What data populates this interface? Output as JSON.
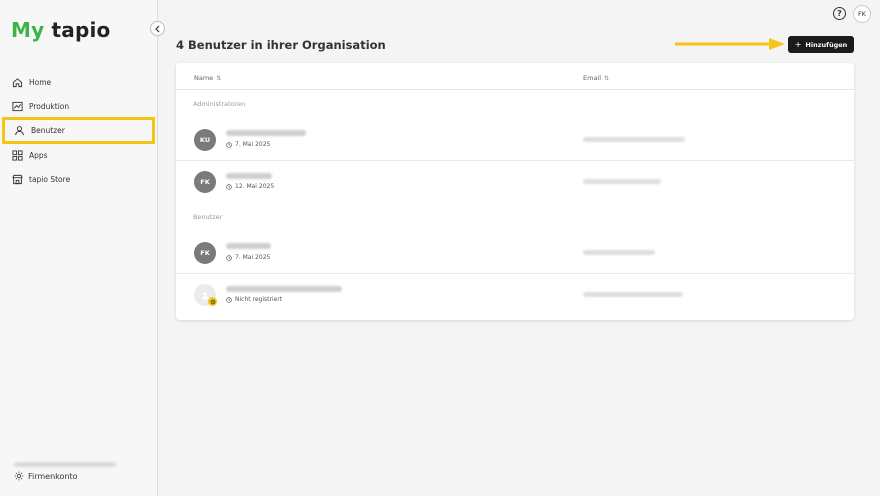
{
  "app": {
    "logo_my": "My",
    "logo_tapio": "tapio"
  },
  "sidebar": {
    "items": [
      {
        "label": "Home",
        "icon": "home-icon"
      },
      {
        "label": "Produktion",
        "icon": "chart-icon"
      },
      {
        "label": "Benutzer",
        "icon": "user-icon",
        "active": true
      },
      {
        "label": "Apps",
        "icon": "apps-grid-icon"
      },
      {
        "label": "tapio Store",
        "icon": "store-icon"
      }
    ],
    "account_label": "Firmenkonto"
  },
  "topbar": {
    "help": "?",
    "avatar_initials": "FK"
  },
  "page": {
    "title": "4 Benutzer in ihrer Organisation",
    "add_button": "Hinzufügen"
  },
  "table": {
    "columns": {
      "name": "Name",
      "email": "Email"
    },
    "groups": [
      {
        "label": "Administratoren",
        "users": [
          {
            "initials": "KU",
            "date": "7. Mai 2025"
          },
          {
            "initials": "FK",
            "date": "12. Mai 2025"
          }
        ]
      },
      {
        "label": "Benutzer",
        "users": [
          {
            "initials": "FK",
            "date": "7. Mai 2025"
          },
          {
            "initials": "",
            "date": "Nicht registriert",
            "pending": true
          }
        ]
      }
    ]
  },
  "colors": {
    "accent_green": "#3bb54a",
    "highlight_yellow": "#f5c518",
    "button_dark": "#1b1b1b"
  }
}
